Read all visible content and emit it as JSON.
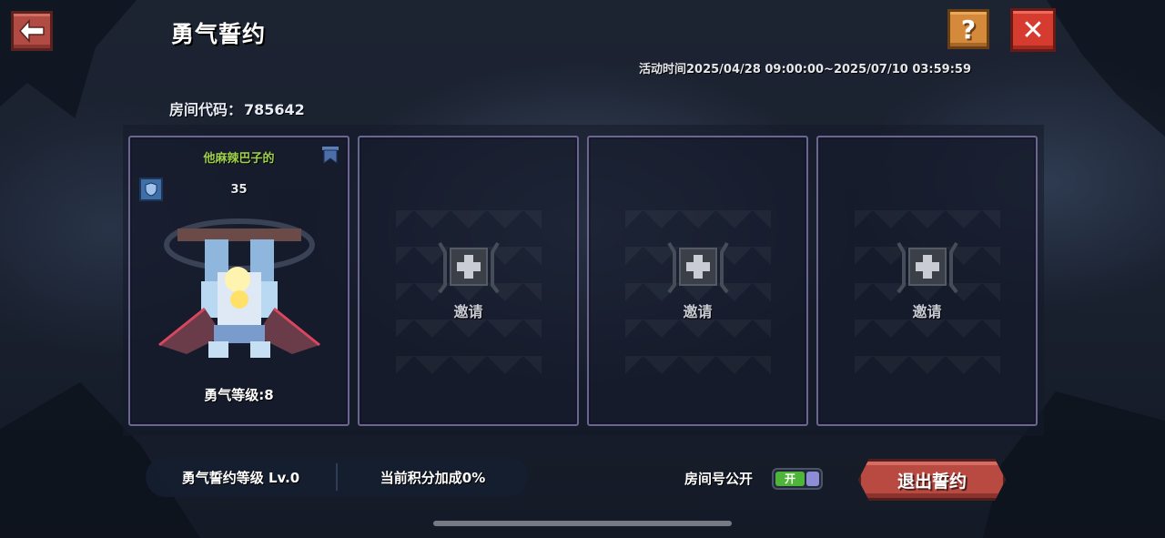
{
  "header": {
    "title": "勇气誓约",
    "back_icon": "arrow-left-icon",
    "help_label": "?",
    "close_label": "✕",
    "event_time": "活动时间2025/04/28 09:00:00~2025/07/10 03:59:59"
  },
  "room": {
    "code_label": "房间代码：",
    "code_value": "785642"
  },
  "slots": [
    {
      "occupied": true,
      "player_name": "他麻辣巴子的",
      "player_level": "35",
      "courage_level": "勇气等级:8",
      "leader_icon": "flag-icon",
      "badge_icon": "shield-icon"
    },
    {
      "occupied": false,
      "invite_label": "邀请"
    },
    {
      "occupied": false,
      "invite_label": "邀请"
    },
    {
      "occupied": false,
      "invite_label": "邀请"
    }
  ],
  "footer": {
    "oath_level": "勇气誓约等级 Lv.0",
    "bonus": "当前积分加成0%",
    "public_label": "房间号公开",
    "toggle_on_text": "开",
    "exit_label": "退出誓约"
  },
  "colors": {
    "player_name": "#9ed04a",
    "exit_button": "#b84a42",
    "close_button": "#d53b2e",
    "help_button": "#d48a3a",
    "slot_border": "#6a6690"
  }
}
